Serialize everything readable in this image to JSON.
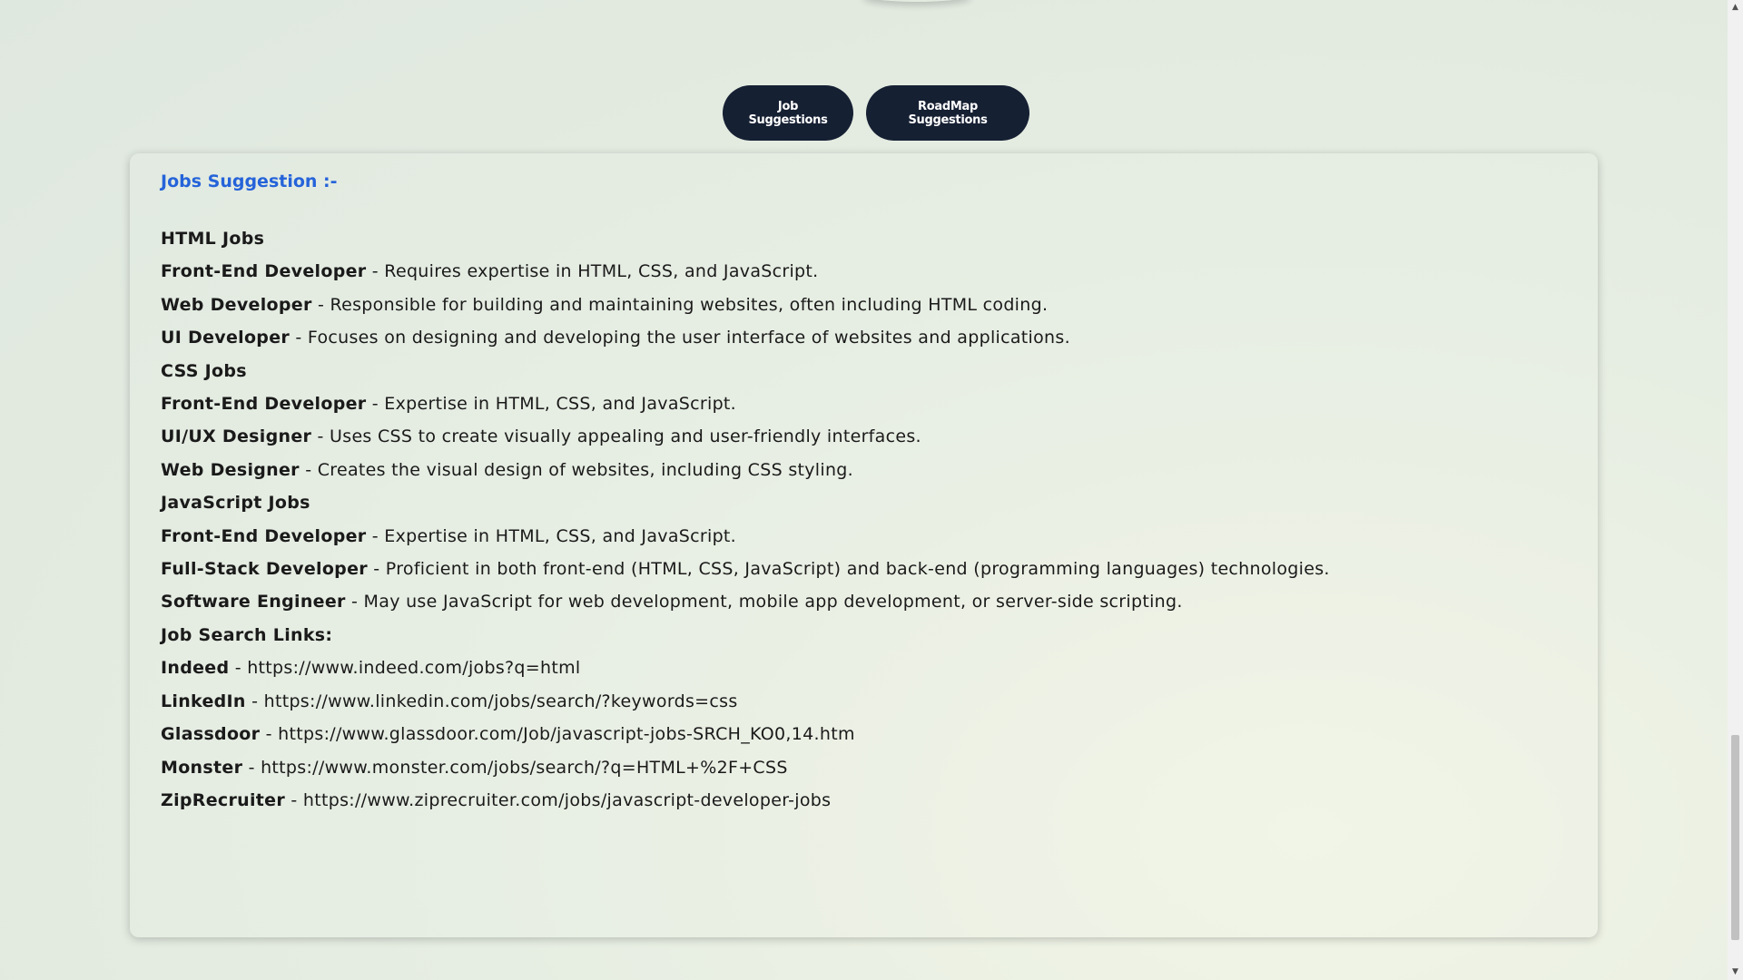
{
  "buttons": {
    "job_suggestions": "Job Suggestions",
    "roadmap_suggestions": "RoadMap Suggestions"
  },
  "card": {
    "title": "Jobs Suggestion :-",
    "html_heading": "HTML Jobs",
    "html_jobs": [
      {
        "role": "Front-End Developer",
        "desc": " - Requires expertise in HTML, CSS, and JavaScript."
      },
      {
        "role": "Web Developer",
        "desc": " - Responsible for building and maintaining websites, often including HTML coding."
      },
      {
        "role": "UI Developer",
        "desc": " - Focuses on designing and developing the user interface of websites and applications."
      }
    ],
    "css_heading": "CSS Jobs",
    "css_jobs": [
      {
        "role": "Front-End Developer",
        "desc": " - Expertise in HTML, CSS, and JavaScript."
      },
      {
        "role": "UI/UX Designer",
        "desc": " - Uses CSS to create visually appealing and user-friendly interfaces."
      },
      {
        "role": "Web Designer",
        "desc": " - Creates the visual design of websites, including CSS styling."
      }
    ],
    "js_heading": "JavaScript Jobs",
    "js_jobs": [
      {
        "role": "Front-End Developer",
        "desc": " - Expertise in HTML, CSS, and JavaScript."
      },
      {
        "role": "Full-Stack Developer",
        "desc": " - Proficient in both front-end (HTML, CSS, JavaScript) and back-end (programming languages) technologies."
      },
      {
        "role": "Software Engineer",
        "desc": " - May use JavaScript for web development, mobile app development, or server-side scripting."
      }
    ],
    "links_heading": "Job Search Links:",
    "links": [
      {
        "site": "Indeed",
        "url": " - https://www.indeed.com/jobs?q=html"
      },
      {
        "site": "LinkedIn",
        "url": " - https://www.linkedin.com/jobs/search/?keywords=css"
      },
      {
        "site": "Glassdoor",
        "url": " - https://www.glassdoor.com/Job/javascript-jobs-SRCH_KO0,14.htm"
      },
      {
        "site": "Monster",
        "url": " - https://www.monster.com/jobs/search/?q=HTML+%2F+CSS"
      },
      {
        "site": "ZipRecruiter",
        "url": " - https://www.ziprecruiter.com/jobs/javascript-developer-jobs"
      }
    ]
  },
  "colors": {
    "button_bg": "#162033",
    "title_blue": "#2563d9"
  },
  "scrollbar": {
    "up_icon": "triangle-up",
    "down_icon": "triangle-down"
  }
}
